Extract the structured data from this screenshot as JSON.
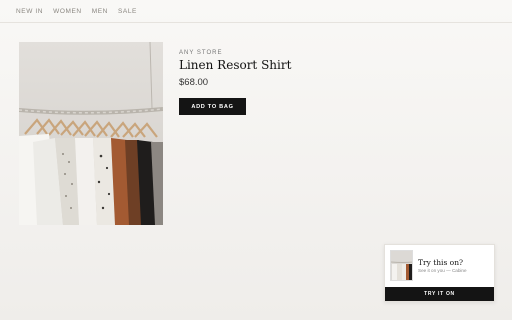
{
  "nav": {
    "items": [
      {
        "label": "NEW IN"
      },
      {
        "label": "WOMEN"
      },
      {
        "label": "MEN"
      },
      {
        "label": "SALE"
      }
    ]
  },
  "product": {
    "store": "ANY STORE",
    "title": "Linen Resort Shirt",
    "price": "$68.00",
    "add_to_bag_label": "ADD TO BAG",
    "image_alt": "clothing rack photo"
  },
  "popup": {
    "title": "Try this on?",
    "subtitle": "See it on you — Cabine",
    "button_label": "TRY IT ON"
  },
  "colors": {
    "primary_button": "#141414",
    "page_background": "#f4f2ef"
  }
}
